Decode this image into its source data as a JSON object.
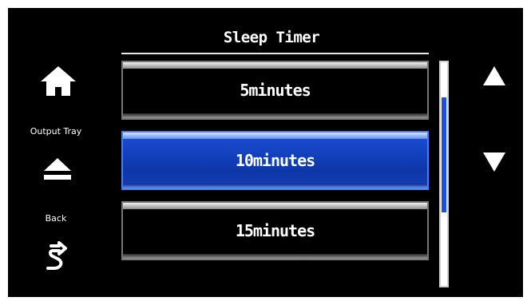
{
  "header": {
    "title": "Sleep Timer"
  },
  "left_panel": {
    "home_icon": "home-icon",
    "output_tray_label": "Output Tray",
    "output_tray_icon": "eject-icon",
    "back_label": "Back",
    "back_icon": "back-arrow-icon"
  },
  "options": {
    "items": [
      {
        "label": "5minutes",
        "selected": false
      },
      {
        "label": "10minutes",
        "selected": true
      },
      {
        "label": "15minutes",
        "selected": false
      }
    ]
  },
  "scroll": {
    "up_icon": "triangle-up-icon",
    "down_icon": "triangle-down-icon",
    "position_fraction": 0.35
  },
  "colors": {
    "background": "#000000",
    "selected": "#1747c8",
    "scroll_thumb": "#1a4fe0",
    "text": "#ffffff"
  }
}
